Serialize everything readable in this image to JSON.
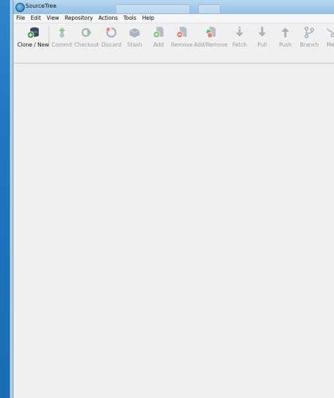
{
  "window": {
    "title": "SourceTree"
  },
  "menu": [
    "File",
    "Edit",
    "View",
    "Repository",
    "Actions",
    "Tools",
    "Help"
  ],
  "toolbar": {
    "clone_new": "Clone / New",
    "commit": "Commit",
    "checkout": "Checkout",
    "discard": "Discard",
    "stash": "Stash",
    "add": "Add",
    "remove": "Remove",
    "add_remove": "Add/Remove",
    "fetch": "Fetch",
    "pull": "Pull",
    "push": "Push",
    "branch": "Branch",
    "merge": "Me"
  },
  "colors": {
    "accent_green": "#3c9a3c",
    "accent_red": "#d9534f",
    "icon_gray": "#9aa7b2",
    "icon_blue": "#3b7fc4"
  }
}
